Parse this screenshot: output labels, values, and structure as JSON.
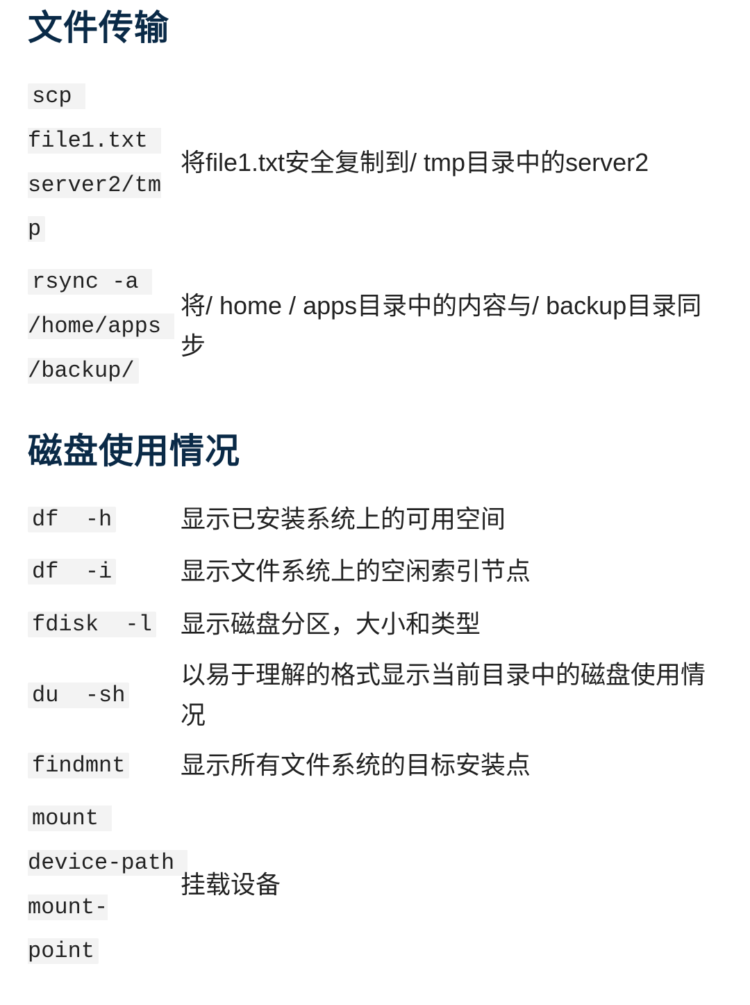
{
  "sections": [
    {
      "heading": "文件传输",
      "rows": [
        {
          "cmd": "scp file1.txt server2/tmp",
          "desc": "将file1.txt安全复制到/ tmp目录中的server2"
        },
        {
          "cmd": "rsync -a /home/apps /backup/",
          "desc": "将/ home / apps目录中的内容与/ backup目录同步"
        }
      ]
    },
    {
      "heading": "磁盘使用情况",
      "rows": [
        {
          "cmd": "df  -h",
          "desc": "显示已安装系统上的可用空间"
        },
        {
          "cmd": "df  -i",
          "desc": "显示文件系统上的空闲索引节点"
        },
        {
          "cmd": "fdisk  -l",
          "desc": "显示磁盘分区，大小和类型"
        },
        {
          "cmd": "du  -sh",
          "desc": "以易于理解的格式显示当前目录中的磁盘使用情况"
        },
        {
          "cmd": "findmnt",
          "desc": "显示所有文件系统的目标安装点"
        },
        {
          "cmd": "mount device-path mount-point",
          "desc": "挂载设备"
        }
      ]
    }
  ]
}
